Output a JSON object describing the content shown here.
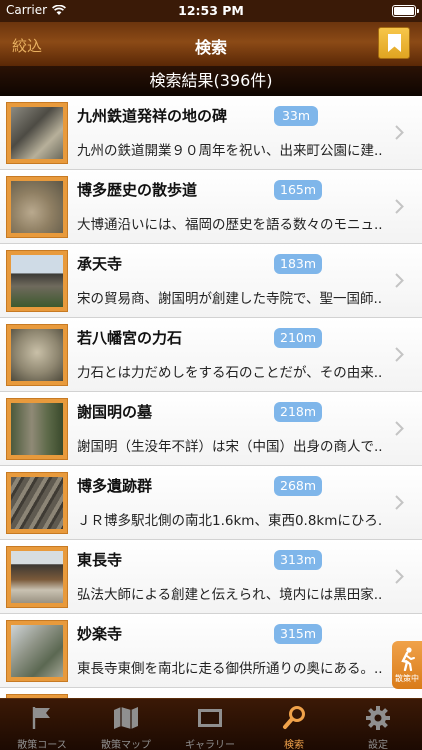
{
  "status_bar": {
    "carrier": "Carrier",
    "time": "12:53 PM"
  },
  "nav": {
    "left_label": "絞込",
    "title": "検索",
    "bookmark_icon": "bookmark-icon"
  },
  "results_header": "検索結果(396件)",
  "rows": [
    {
      "title": "九州鉄道発祥の地の碑",
      "distance": "33m",
      "desc": "九州の鉄道開業９０周年を祝い、出来町公園に建..."
    },
    {
      "title": "博多歴史の散歩道",
      "distance": "165m",
      "desc": "大博通沿いには、福岡の歴史を語る数々のモニュ..."
    },
    {
      "title": "承天寺",
      "distance": "183m",
      "desc": "宋の貿易商、謝国明が創建した寺院で、聖一国師..."
    },
    {
      "title": "若八幡宮の力石",
      "distance": "210m",
      "desc": "力石とは力だめしをする石のことだが、その由来..."
    },
    {
      "title": "謝国明の墓",
      "distance": "218m",
      "desc": "謝国明（生没年不詳）は宋（中国）出身の商人で..."
    },
    {
      "title": "博多遺跡群",
      "distance": "268m",
      "desc": "ＪＲ博多駅北側の南北1.6km、東西0.8kmにひろ..."
    },
    {
      "title": "東長寺",
      "distance": "313m",
      "desc": "弘法大師による創建と伝えられ、境内には黒田家..."
    },
    {
      "title": "妙楽寺",
      "distance": "315m",
      "desc": "東長寺東側を南北に走る御供所通りの奥にある。..."
    }
  ],
  "float_button": {
    "label": "散策中",
    "icon": "walking-person-icon"
  },
  "tabs": [
    {
      "label": "散策コース",
      "icon": "flag-icon",
      "active": false
    },
    {
      "label": "散策マップ",
      "icon": "map-icon",
      "active": false
    },
    {
      "label": "ギャラリー",
      "icon": "gallery-icon",
      "active": false
    },
    {
      "label": "検索",
      "icon": "search-icon",
      "active": true
    },
    {
      "label": "設定",
      "icon": "gear-icon",
      "active": false
    }
  ],
  "colors": {
    "accent": "#f0a24a",
    "distance_badge": "#7fb6ea",
    "thumb_frame": "#e89a3c"
  }
}
